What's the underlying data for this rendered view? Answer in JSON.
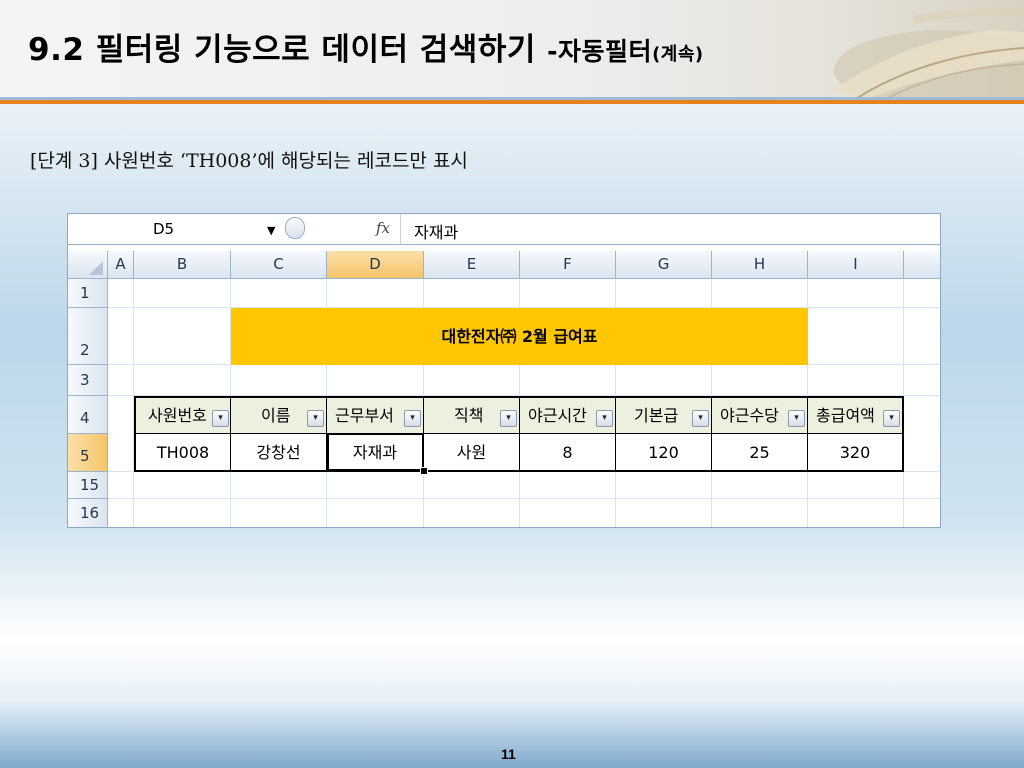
{
  "slide": {
    "title_main": "9.2 필터링 기능으로 데이터 검색하기 ",
    "title_sub": "-자동필터",
    "title_sub2": "(계속)",
    "step_text": "[단계 3] 사원번호 ‘TH008’에 해당되는 레코드만 표시",
    "page_number": "11"
  },
  "formula_bar": {
    "name_box": "D5",
    "dropdown_glyph": "▼",
    "fx_label": "fx",
    "value": "자재과"
  },
  "columns": [
    "A",
    "B",
    "C",
    "D",
    "E",
    "F",
    "G",
    "H",
    "I"
  ],
  "selected_column": "D",
  "rows": [
    "1",
    "2",
    "3",
    "4",
    "5",
    "15",
    "16"
  ],
  "selected_row": "5",
  "banner": {
    "text": "대한전자㈜ 2월 급여표",
    "color": "#ffc702"
  },
  "table": {
    "headers": [
      "사원번호",
      "이름",
      "근무부서",
      "직책",
      "야근시간",
      "기본급",
      "야근수당",
      "총급여액"
    ],
    "header_icons": [
      "filter-funnel",
      "dropdown",
      "dropdown",
      "dropdown",
      "dropdown",
      "dropdown",
      "dropdown",
      "dropdown"
    ],
    "row": [
      "TH008",
      "강창선",
      "자재과",
      "사원",
      "8",
      "120",
      "25",
      "320"
    ]
  },
  "colors": {
    "header_fill": "#ebf1de",
    "accent_orange": "#e8821f",
    "selected_header": "#f5c56a"
  }
}
